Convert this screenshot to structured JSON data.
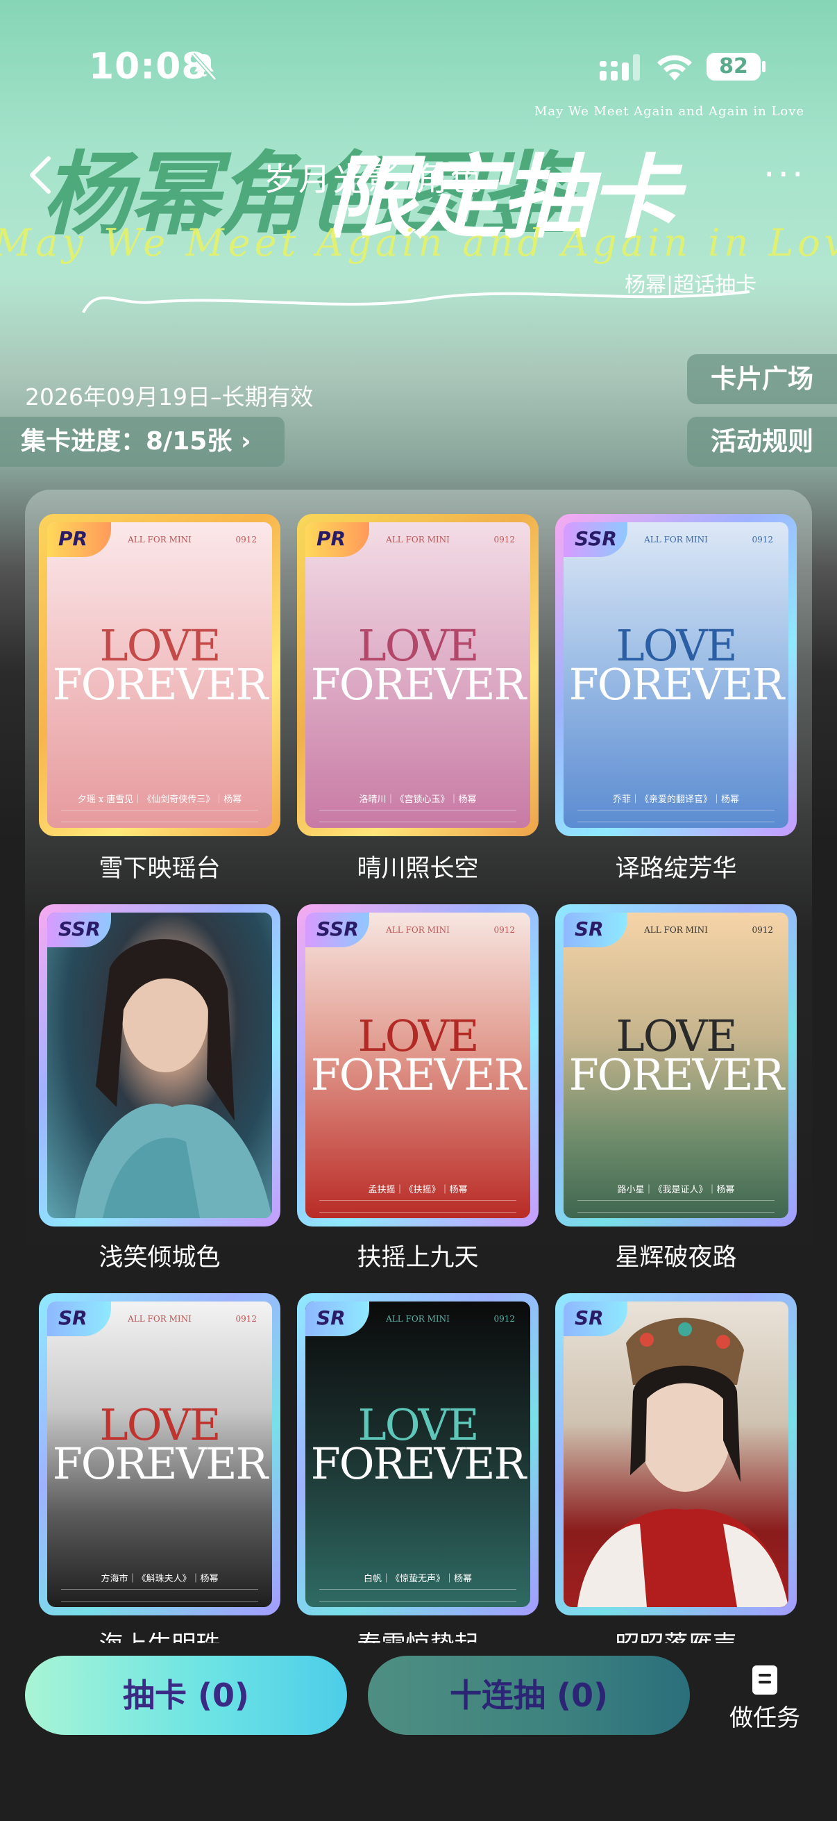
{
  "status_bar": {
    "time": "10:08",
    "battery": "82"
  },
  "banner": {
    "tagline_small": "May We Meet Again and Again in Love",
    "title_main": "杨幂角色图鉴",
    "title_overlay": "限定抽卡",
    "script_text": "May We Meet Again and Again in Love",
    "subtitle": "杨幂|超话抽卡"
  },
  "nav": {
    "title": "岁月光影·角色",
    "more": "···"
  },
  "validity": "2026年09月19日–长期有效",
  "progress_label": "集卡进度：8/15张 ›",
  "side_buttons": {
    "plaza": "卡片广场",
    "rules": "活动规则"
  },
  "cards": [
    {
      "rarity": "PR",
      "brand": "ALL FOR MINI",
      "no": "0912",
      "credit": "夕瑶 x 唐雪见｜《仙剑奇侠传三》｜杨幂",
      "name": "雪下映瑶台"
    },
    {
      "rarity": "PR",
      "brand": "ALL FOR MINI",
      "no": "0912",
      "credit": "洛晴川｜《宫锁心玉》｜杨幂",
      "name": "晴川照长空"
    },
    {
      "rarity": "SSR",
      "brand": "ALL FOR MINI",
      "no": "0912",
      "credit": "乔菲｜《亲爱的翻译官》｜杨幂",
      "name": "译路绽芳华"
    },
    {
      "rarity": "SSR",
      "name": "浅笑倾城色"
    },
    {
      "rarity": "SSR",
      "brand": "ALL FOR MINI",
      "no": "0912",
      "credit": "孟扶摇｜《扶摇》｜杨幂",
      "name": "扶摇上九天"
    },
    {
      "rarity": "SR",
      "brand": "ALL FOR MINI",
      "no": "0912",
      "credit": "路小星｜《我是证人》｜杨幂",
      "name": "星辉破夜路"
    },
    {
      "rarity": "SR",
      "brand": "ALL FOR MINI",
      "no": "0912",
      "credit": "方海市｜《斛珠夫人》｜杨幂",
      "name": "海上生明珠"
    },
    {
      "rarity": "SR",
      "brand": "ALL FOR MINI",
      "no": "0912",
      "credit": "白帆｜《惊蛰无声》｜杨幂",
      "name": "春雷惊蛰起"
    },
    {
      "rarity": "SR",
      "name": "昭昭落雁声"
    }
  ],
  "buttons": {
    "draw": "抽卡 (0)",
    "ten_draw": "十连抽 (0)",
    "tasks": "做任务"
  },
  "colors": {
    "accent_green": "#86d5b6",
    "draw_gradient_start": "#a8f5d4",
    "draw_gradient_end": "#4dcde9",
    "button_text": "#3a2a84"
  }
}
